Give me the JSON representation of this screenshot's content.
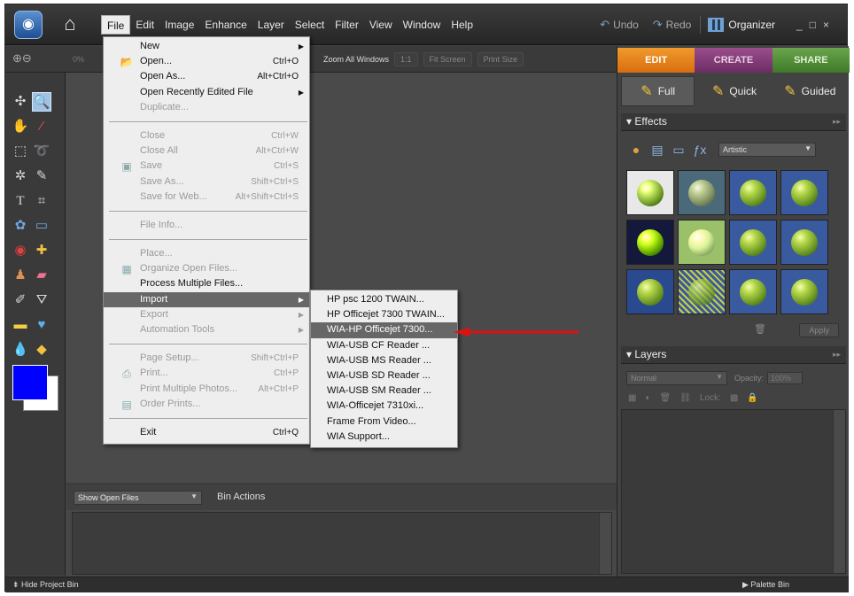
{
  "menubar": {
    "items": [
      "File",
      "Edit",
      "Image",
      "Enhance",
      "Layer",
      "Select",
      "Filter",
      "View",
      "Window",
      "Help"
    ],
    "active": "File"
  },
  "toolbar": {
    "undo": "Undo",
    "redo": "Redo",
    "organizer": "Organizer",
    "minimize": "_",
    "maximize": "□",
    "close": "×"
  },
  "options": {
    "zoom_pct": "0%",
    "zoom_all": "Zoom All Windows",
    "one_to_one": "1:1",
    "fit_screen": "Fit Screen",
    "print_size": "Print Size"
  },
  "mode_tabs": [
    "EDIT",
    "CREATE",
    "SHARE"
  ],
  "sub_tabs": [
    "Full",
    "Quick",
    "Guided"
  ],
  "effects": {
    "title": "Effects",
    "category": "Artistic",
    "apply": "Apply"
  },
  "layers": {
    "title": "Layers",
    "blend": "Normal",
    "opacity_label": "Opacity:",
    "opacity_value": "100%",
    "lock": "Lock:"
  },
  "bin": {
    "select": "Show Open Files",
    "actions": "Bin Actions"
  },
  "status": {
    "hide_bin": "Hide Project Bin",
    "palette_bin": "Palette Bin"
  },
  "file_menu": {
    "g1": [
      {
        "label": "New",
        "shortcut": "",
        "submenu": true,
        "disabled": false,
        "icon": ""
      },
      {
        "label": "Open...",
        "shortcut": "Ctrl+O",
        "submenu": false,
        "disabled": false,
        "icon": "folder-icon"
      },
      {
        "label": "Open As...",
        "shortcut": "Alt+Ctrl+O",
        "submenu": false,
        "disabled": false,
        "icon": ""
      },
      {
        "label": "Open Recently Edited File",
        "shortcut": "",
        "submenu": true,
        "disabled": false,
        "icon": ""
      },
      {
        "label": "Duplicate...",
        "shortcut": "",
        "submenu": false,
        "disabled": true,
        "icon": ""
      }
    ],
    "g2": [
      {
        "label": "Close",
        "shortcut": "Ctrl+W",
        "disabled": true,
        "icon": ""
      },
      {
        "label": "Close All",
        "shortcut": "Alt+Ctrl+W",
        "disabled": true,
        "icon": ""
      },
      {
        "label": "Save",
        "shortcut": "Ctrl+S",
        "disabled": true,
        "icon": "save-icon"
      },
      {
        "label": "Save As...",
        "shortcut": "Shift+Ctrl+S",
        "disabled": true,
        "icon": ""
      },
      {
        "label": "Save for Web...",
        "shortcut": "Alt+Shift+Ctrl+S",
        "disabled": true,
        "icon": ""
      }
    ],
    "g3": [
      {
        "label": "File Info...",
        "shortcut": "",
        "disabled": true
      }
    ],
    "g4": [
      {
        "label": "Place...",
        "disabled": true,
        "icon": ""
      },
      {
        "label": "Organize Open Files...",
        "disabled": true,
        "icon": "grid-icon"
      },
      {
        "label": "Process Multiple Files...",
        "disabled": false,
        "icon": ""
      },
      {
        "label": "Import",
        "disabled": false,
        "submenu": true,
        "highlighted": true,
        "icon": ""
      },
      {
        "label": "Export",
        "disabled": true,
        "submenu": true,
        "icon": ""
      },
      {
        "label": "Automation Tools",
        "disabled": true,
        "submenu": true,
        "icon": ""
      }
    ],
    "g5": [
      {
        "label": "Page Setup...",
        "shortcut": "Shift+Ctrl+P",
        "disabled": true,
        "icon": ""
      },
      {
        "label": "Print...",
        "shortcut": "Ctrl+P",
        "disabled": true,
        "icon": "printer-icon"
      },
      {
        "label": "Print Multiple Photos...",
        "shortcut": "Alt+Ctrl+P",
        "disabled": true,
        "icon": ""
      },
      {
        "label": "Order Prints...",
        "shortcut": "",
        "disabled": true,
        "icon": "order-icon"
      }
    ],
    "g6": [
      {
        "label": "Exit",
        "shortcut": "Ctrl+Q",
        "disabled": false
      }
    ]
  },
  "import_submenu": [
    "HP psc 1200 TWAIN...",
    "HP Officejet 7300 TWAIN...",
    "WIA-HP Officejet 7300...",
    "WIA-USB CF Reader ...",
    "WIA-USB MS Reader ...",
    "WIA-USB SD Reader ...",
    "WIA-USB SM Reader ...",
    "WIA-Officejet 7310xi...",
    "Frame From Video...",
    "WIA Support..."
  ],
  "import_highlighted": 2,
  "colors": {
    "foreground": "#0000ff",
    "background": "#ffffff",
    "edit_tab": "#e8821e",
    "create_tab": "#7f3b74",
    "share_tab": "#4f8d37",
    "annotation_arrow": "#e01010"
  }
}
